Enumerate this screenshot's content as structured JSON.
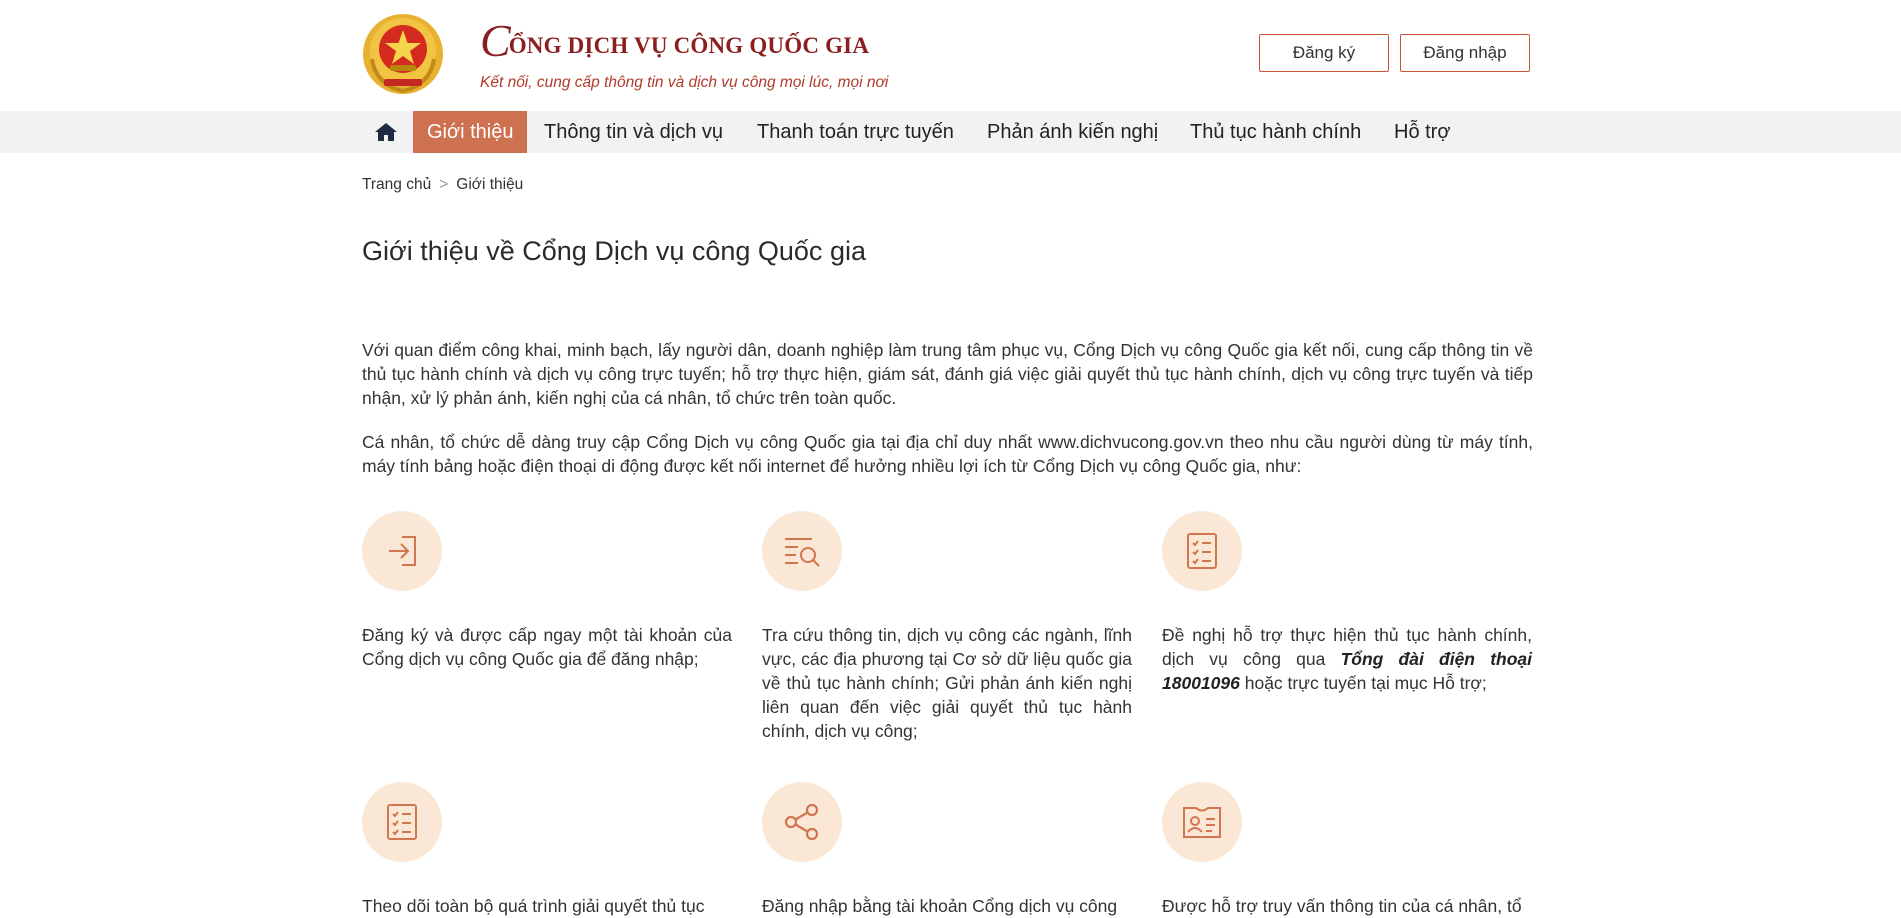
{
  "header": {
    "logo_initial": "C",
    "logo_rest": "ỔNG DỊCH VỤ CÔNG QUỐC GIA",
    "tagline": "Kết nối, cung cấp thông tin và dịch vụ công mọi lúc, mọi nơi",
    "register_label": "Đăng ký",
    "login_label": "Đăng nhập"
  },
  "nav": {
    "home_icon": "home-icon",
    "items": [
      {
        "label": "Giới thiệu",
        "active": true
      },
      {
        "label": "Thông tin và dịch vụ"
      },
      {
        "label": "Thanh toán trực tuyến"
      },
      {
        "label": "Phản ánh kiến nghị"
      },
      {
        "label": "Thủ tục hành chính"
      },
      {
        "label": "Hỗ trợ"
      }
    ]
  },
  "breadcrumb": {
    "home": "Trang chủ",
    "separator": ">",
    "current": "Giới thiệu"
  },
  "page": {
    "title": "Giới thiệu về Cổng Dịch vụ công Quốc gia",
    "para1": "Với quan điểm công khai, minh bạch, lấy người dân, doanh nghiệp làm trung tâm phục vụ, Cổng Dịch vụ công Quốc gia kết nối, cung cấp thông tin về thủ tục hành chính và dịch vụ công trực tuyến; hỗ trợ thực hiện, giám sát, đánh giá việc giải quyết thủ tục hành chính, dịch vụ công trực tuyến và tiếp nhận, xử lý phản ánh, kiến nghị của cá nhân, tổ chức trên toàn quốc.",
    "para2": "Cá nhân, tổ chức dễ dàng truy cập Cổng Dịch vụ công Quốc gia tại địa chỉ duy nhất www.dichvucong.gov.vn theo nhu cầu người dùng từ máy tính, máy tính bảng hoặc điện thoại di động được kết nối internet để hưởng nhiều lợi ích từ Cổng Dịch vụ công Quốc gia, như:"
  },
  "features": [
    {
      "icon": "login-arrow-icon",
      "text": "Đăng ký và được cấp ngay một tài khoản của Cổng dịch vụ công Quốc gia để đăng nhập;"
    },
    {
      "icon": "search-list-icon",
      "text": "Tra cứu thông tin, dịch vụ công các ngành, lĩnh vực, các địa phương tại Cơ sở dữ liệu quốc gia về thủ tục hành chính; Gửi phản ánh kiến nghị liên quan đến việc giải quyết thủ tục hành chính, dịch vụ công;"
    },
    {
      "icon": "checklist-icon",
      "text_before": "Đề nghị hỗ trợ thực hiện thủ tục hành chính, dịch vụ công qua ",
      "text_bold": "Tổng đài điện thoại 18001096",
      "text_after": " hoặc trực tuyến tại mục Hỗ trợ;"
    },
    {
      "icon": "checklist-icon",
      "text": "Theo dõi toàn bộ quá trình giải quyết thủ tục"
    },
    {
      "icon": "share-icon",
      "text": "Đăng nhập bằng tài khoản Cổng dịch vụ công"
    },
    {
      "icon": "id-card-icon",
      "text": "Được hỗ trợ truy vấn thông tin của cá nhân, tổ"
    }
  ],
  "colors": {
    "brand_red": "#8b1f1f",
    "accent": "#cd7151",
    "icon_bg": "#fbe7d5",
    "icon_stroke": "#d2764f"
  }
}
